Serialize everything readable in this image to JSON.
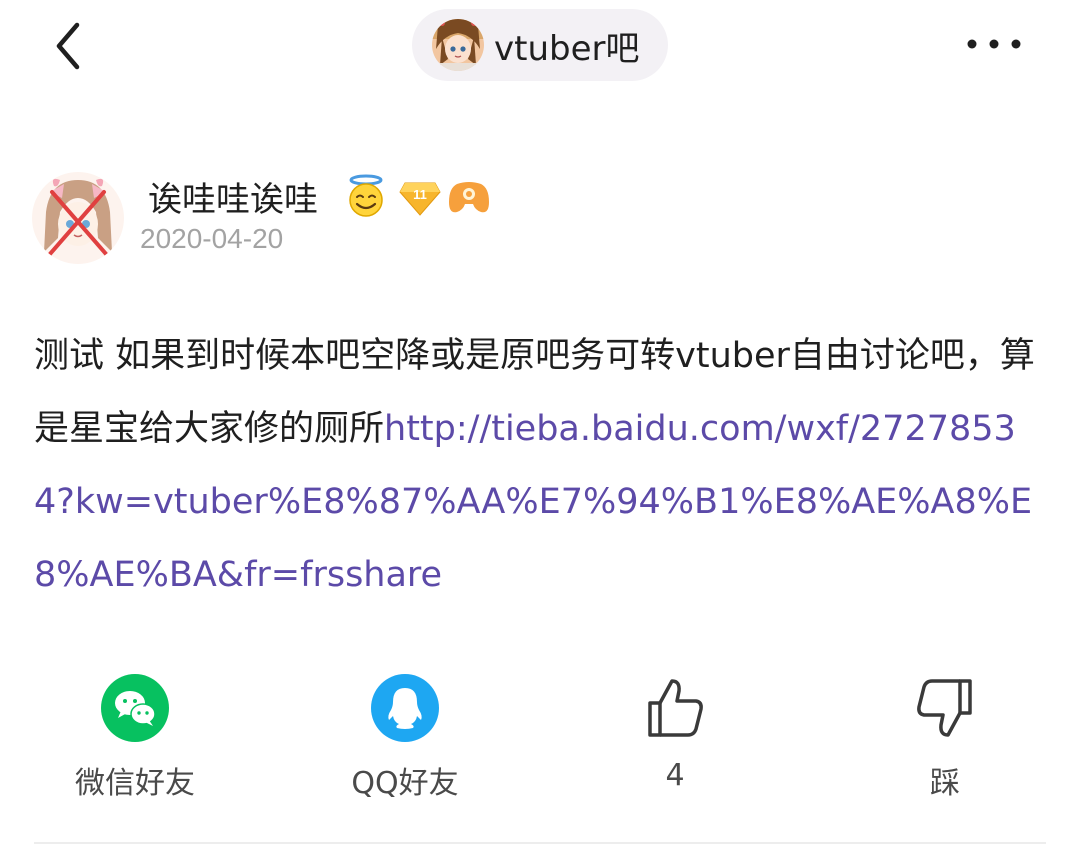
{
  "header": {
    "forum_name": "vtuber吧"
  },
  "post": {
    "author_name": "诶哇哇诶哇",
    "author_emoji": "smiling-face-with-halo-icon",
    "level": "11",
    "date": "2020-04-20",
    "text": "测试 如果到时候本吧空降或是原吧务可转vtuber自由讨论吧，算是星宝给大家修的厕所",
    "link": "http://tieba.baidu.com/wxf/27278534?kw=vtuber%E8%87%AA%E7%94%B1%E8%AE%A8%E8%AE%BA&fr=frsshare"
  },
  "actions": {
    "wechat_label": "微信好友",
    "qq_label": "QQ好友",
    "like_count": "4",
    "dislike_label": "踩"
  },
  "colors": {
    "link": "#5c4aa8",
    "wechat_green": "#07c160",
    "qq_blue": "#1ea7f2",
    "date_gray": "#a3a3a3",
    "pill_bg": "#f3f1f5"
  }
}
